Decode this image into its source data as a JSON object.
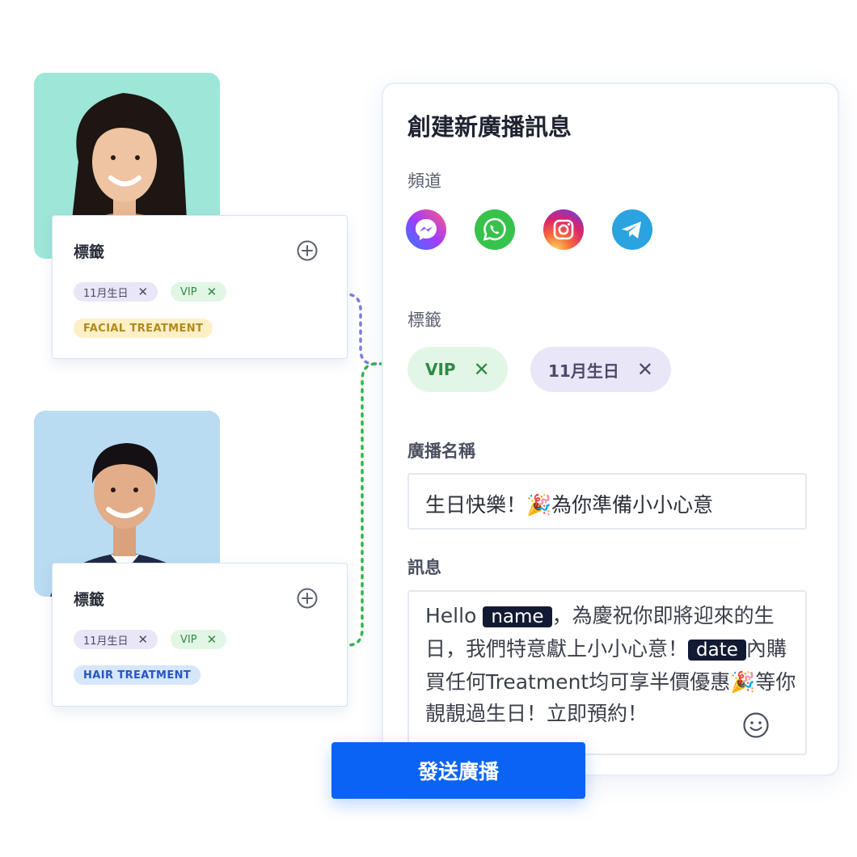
{
  "contact_cards": [
    {
      "title": "標籤",
      "tags": [
        {
          "label": "11月生日",
          "removable": true,
          "color": "purple"
        },
        {
          "label": "VIP",
          "removable": true,
          "color": "green"
        },
        {
          "label": "FACIAL TREATMENT",
          "removable": false,
          "color": "yellow"
        }
      ],
      "add_icon": "plus-circle-icon"
    },
    {
      "title": "標籤",
      "tags": [
        {
          "label": "11月生日",
          "removable": true,
          "color": "purple"
        },
        {
          "label": "VIP",
          "removable": true,
          "color": "green"
        },
        {
          "label": "HAIR TREATMENT",
          "removable": false,
          "color": "blue"
        }
      ],
      "add_icon": "plus-circle-icon"
    }
  ],
  "broadcast_form": {
    "title": "創建新廣播訊息",
    "channels_label": "頻道",
    "channels": [
      "messenger-icon",
      "whatsapp-icon",
      "instagram-icon",
      "telegram-icon"
    ],
    "tags_label": "標籤",
    "tags": [
      {
        "label": "VIP",
        "color": "green"
      },
      {
        "label": "11月生日",
        "color": "purple"
      }
    ],
    "name_label": "廣播名稱",
    "name_value": "生日快樂！🎉為你準備小小心意",
    "message_label": "訊息",
    "message": {
      "part1": "Hello ",
      "var_name": "name",
      "part2": "，為慶祝你即將迎來的生日，我們特意獻上小小心意！",
      "var_date": "date",
      "part3": "內購買任何Treatment均可享半價優惠🎉等你靚靚過生日！立即預約！"
    },
    "send_button": "發送廣播"
  },
  "colors": {
    "primary": "#0b63f6",
    "tag_green_bg": "#e2f6e6",
    "tag_purple_bg": "#e9e6f8",
    "tag_yellow_bg": "#fdf0c7",
    "tag_blue_bg": "#d6e6fb",
    "connector_purple": "#7b7fe0",
    "connector_green": "#2fb84a"
  }
}
